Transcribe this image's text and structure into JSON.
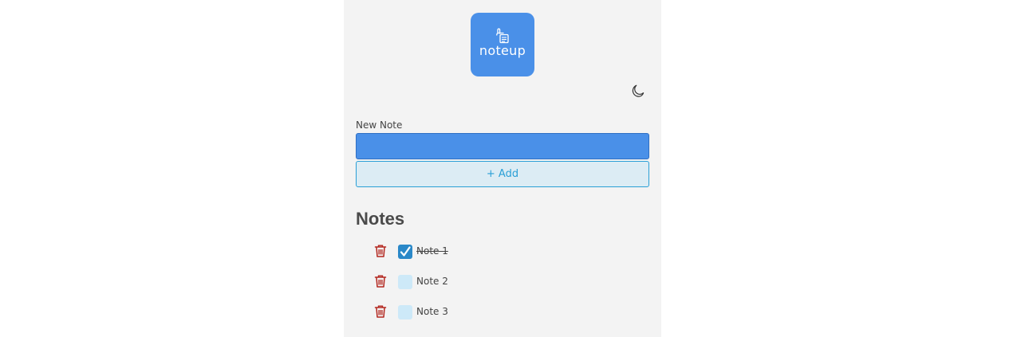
{
  "app": {
    "logo_text": "noteup",
    "logo_icon": "hand-note-icon",
    "theme_toggle_icon": "moon-icon"
  },
  "form": {
    "label": "New Note",
    "input_value": "",
    "add_label": "+ Add"
  },
  "notes": {
    "heading": "Notes",
    "items": [
      {
        "text": "Note 1",
        "checked": true
      },
      {
        "text": "Note 2",
        "checked": false
      },
      {
        "text": "Note 3",
        "checked": false
      }
    ]
  },
  "colors": {
    "brand": "#4a90e8",
    "accent": "#2a9fd6",
    "delete": "#b3261e"
  }
}
